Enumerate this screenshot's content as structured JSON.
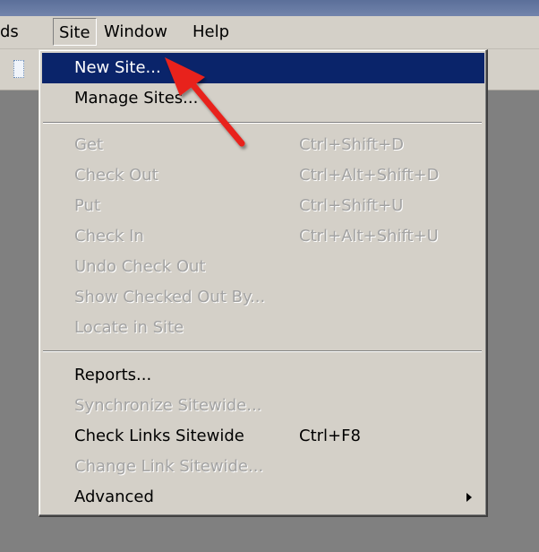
{
  "menubar": {
    "items": [
      {
        "label": "ds"
      },
      {
        "label": "Site"
      },
      {
        "label": "Window"
      },
      {
        "label": "Help"
      }
    ]
  },
  "site_menu": {
    "items": [
      {
        "label": "New Site...",
        "shortcut": "",
        "state": "highlighted"
      },
      {
        "label": "Manage Sites...",
        "shortcut": "",
        "state": "enabled"
      },
      {
        "label": "Get",
        "shortcut": "Ctrl+Shift+D",
        "state": "disabled"
      },
      {
        "label": "Check Out",
        "shortcut": "Ctrl+Alt+Shift+D",
        "state": "disabled"
      },
      {
        "label": "Put",
        "shortcut": "Ctrl+Shift+U",
        "state": "disabled"
      },
      {
        "label": "Check In",
        "shortcut": "Ctrl+Alt+Shift+U",
        "state": "disabled"
      },
      {
        "label": "Undo Check Out",
        "shortcut": "",
        "state": "disabled"
      },
      {
        "label": "Show Checked Out By...",
        "shortcut": "",
        "state": "disabled"
      },
      {
        "label": "Locate in Site",
        "shortcut": "",
        "state": "disabled"
      },
      {
        "label": "Reports...",
        "shortcut": "",
        "state": "enabled"
      },
      {
        "label": "Synchronize Sitewide...",
        "shortcut": "",
        "state": "disabled"
      },
      {
        "label": "Check Links Sitewide",
        "shortcut": "Ctrl+F8",
        "state": "enabled"
      },
      {
        "label": "Change Link Sitewide...",
        "shortcut": "",
        "state": "disabled"
      },
      {
        "label": "Advanced",
        "shortcut": "",
        "state": "enabled",
        "submenu_icon": "triangle-right-icon"
      }
    ]
  },
  "annotation": {
    "icon": "red-arrow-icon",
    "color": "#e8201c"
  },
  "colors": {
    "highlight": "#0a246a",
    "menu_bg": "#d4d0c8",
    "disabled_text": "#a3a3a3"
  }
}
